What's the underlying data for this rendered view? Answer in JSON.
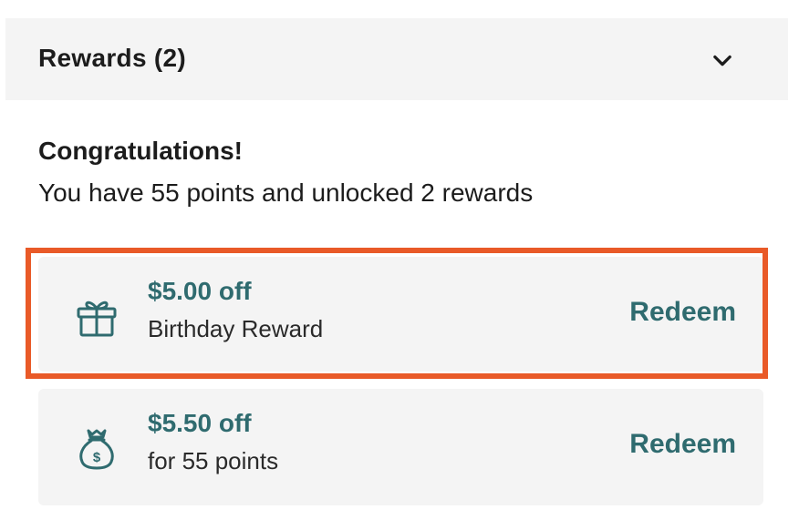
{
  "header": {
    "title": "Rewards (2)",
    "toggle_icon": "chevron-down-icon"
  },
  "summary": {
    "heading": "Congratulations!",
    "text": "You have 55 points and unlocked 2 rewards"
  },
  "rewards": [
    {
      "icon": "gift-icon",
      "amount": "$5.00 off",
      "description": "Birthday Reward",
      "action": "Redeem",
      "highlighted": true
    },
    {
      "icon": "money-bag-icon",
      "amount": "$5.50 off",
      "description": "for 55 points",
      "action": "Redeem",
      "highlighted": false
    }
  ],
  "colors": {
    "accent": "#2f6b6f",
    "highlight_border": "#e95a28",
    "card_background": "#f4f4f4"
  }
}
